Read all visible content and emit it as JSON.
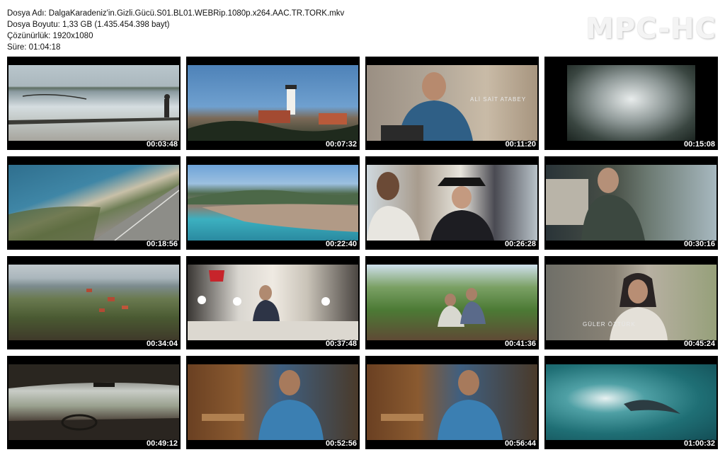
{
  "file_info": {
    "name_line": "Dosya Adı: DalgaKaradeniz'in.Gizli.Gücü.S01.BL01.WEBRip.1080p.x264.AAC.TR.TORK.mkv",
    "size_line": "Dosya Boyutu: 1,33 GB (1.435.454.398 bayt)",
    "resolution_line": "Çözünürlük: 1920x1080",
    "duration_line": "Süre: 01:04:18"
  },
  "logo": "MPC-HC",
  "thumbnails": [
    {
      "time": "00:03:48"
    },
    {
      "time": "00:07:32"
    },
    {
      "time": "00:11:20",
      "caption": "ALİ SAİT ATABEY"
    },
    {
      "time": "00:15:08"
    },
    {
      "time": "00:18:56"
    },
    {
      "time": "00:22:40"
    },
    {
      "time": "00:26:28"
    },
    {
      "time": "00:30:16"
    },
    {
      "time": "00:34:04"
    },
    {
      "time": "00:37:48"
    },
    {
      "time": "00:41:36"
    },
    {
      "time": "00:45:24",
      "caption": "GÜLER ÖZTÜRK"
    },
    {
      "time": "00:49:12"
    },
    {
      "time": "00:52:56"
    },
    {
      "time": "00:56:44"
    },
    {
      "time": "01:00:32"
    }
  ]
}
